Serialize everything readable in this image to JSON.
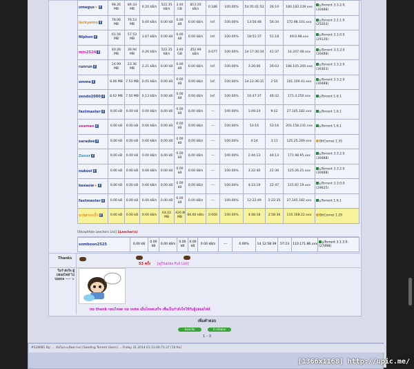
{
  "peers": [
    {
      "user": "omegus",
      "color": "#223a9a",
      "star": "★",
      "ul": "98.26 MB",
      "dl": "89.33 MB",
      "ul_rate": "0.20 kB/s",
      "dl_rate": "522.35 kB/s",
      "size": "3.40 GB",
      "ratio_rate": "813.20 kB/s",
      "ratio": "0.186",
      "ratio_red": true,
      "complete": "100.00%",
      "connected": "5d 05:41:53",
      "idle": "26:10",
      "ip": "180.183.239.xxx",
      "client": "µTorrent 3.3.2.0. (30488)",
      "client_icon": "flag"
    },
    {
      "user": "luckyemu",
      "color": "#e09020",
      "star": "",
      "ul": "78.06 MB",
      "dl": "76.53 MB",
      "ul_rate": "0.00 kB/s",
      "dl_rate": "0.00 kB",
      "size": "0.00 kB",
      "ratio_rate": "0.00 kB/s",
      "ratio": "Inf.",
      "ratio_red": false,
      "complete": "100.00%",
      "connected": "13:56:48",
      "idle": "56:34",
      "ip": "172.98.101.xxx",
      "client": "µTorrent 2.2.1.0. (25203)",
      "client_icon": "flag"
    },
    {
      "user": "Niphon",
      "color": "#223a9a",
      "star": "",
      "ul": "61.56 MB",
      "dl": "57.53 MB",
      "ul_rate": "1.67 kB/s",
      "dl_rate": "0.00 kB",
      "size": "0.00 kB",
      "ratio_rate": "0.00 kB/s",
      "ratio": "Inf.",
      "ratio_red": false,
      "complete": "100.00%",
      "connected": "18:51:37",
      "idle": "51:18",
      "ip": "49.0.98.xxx",
      "client": "µTorrent 3.3.0.0. (29126)",
      "client_icon": "flag"
    },
    {
      "user": "min2524",
      "color": "#d020a0",
      "star": "",
      "ul": "40.26 MB",
      "dl": "36.94 MB",
      "ul_rate": "0.26 kB/s",
      "dl_rate": "522.35 kB/s",
      "size": "3.40 GB",
      "ratio_rate": "352.99 kB/s",
      "ratio": "0.077",
      "ratio_red": true,
      "complete": "100.00%",
      "connected": "1d 17:30:34",
      "idle": "41:37",
      "ip": "14.207.48.xxx",
      "client": "µTorrent 3.3.2.0. (30488)",
      "client_icon": "flag"
    },
    {
      "user": "runrun",
      "color": "#223a9a",
      "star": "",
      "ul": "24.99 MB",
      "dl": "23.36 MB",
      "ul_rate": "2.21 kB/s",
      "dl_rate": "0.00 kB",
      "size": "0.00 kB",
      "ratio_rate": "0.00 kB/s",
      "ratio": "Inf.",
      "ratio_red": false,
      "complete": "100.00%",
      "connected": "3:26:06",
      "idle": "26:03",
      "ip": "184.105.205.xxx",
      "client": "µTorrent 3.3.2.0. (30303)",
      "client_icon": "flag"
    },
    {
      "user": "emme",
      "color": "#223a9a",
      "star": "",
      "ul": "8.06 MB",
      "dl": "7.53 MB",
      "ul_rate": "0.05 kB/s",
      "dl_rate": "0.00 kB",
      "size": "0.00 kB",
      "ratio_rate": "0.00 kB/s",
      "ratio": "Inf.",
      "ratio_red": false,
      "complete": "100.00%",
      "connected": "1d 23:36:31",
      "idle": "2:55",
      "ip": "101.109.41.xxx",
      "client": "µTorrent 3.3.2.0. (30488)",
      "client_icon": "flag"
    },
    {
      "user": "zendo2000",
      "color": "#223a9a",
      "star": "",
      "ul": "8.02 MB",
      "dl": "7.50 MB",
      "ul_rate": "0.13 kB/s",
      "dl_rate": "0.00 kB",
      "size": "0.00 kB",
      "ratio_rate": "0.00 kB/s",
      "ratio": "Inf.",
      "ratio_red": false,
      "complete": "100.00%",
      "connected": "16:47:37",
      "idle": "46:42",
      "ip": "171.4.250.xxx",
      "client": "µTorrent 1.6.1",
      "client_icon": "flag"
    },
    {
      "user": "fastmaster",
      "color": "#223a9a",
      "star": "",
      "ul": "0.00 kB",
      "dl": "0.00 kB",
      "ul_rate": "0.00 kB/s",
      "dl_rate": "0.00 kB",
      "size": "0.00 kB",
      "ratio_rate": "0.00 kB/s",
      "ratio": "---",
      "ratio_red": false,
      "complete": "100.00%",
      "connected": "1:09:24",
      "idle": "9:22",
      "ip": "27.145.182.xxx",
      "client": "µTorrent 1.6.1",
      "client_icon": "flag"
    },
    {
      "user": "seaman",
      "color": "#d020a0",
      "star": "",
      "ul": "0.00 kB",
      "dl": "0.00 kB",
      "ul_rate": "0.00 kB/s",
      "dl_rate": "0.00 kB",
      "size": "0.00 kB",
      "ratio_rate": "0.00 kB/s",
      "ratio": "---",
      "ratio_red": false,
      "complete": "100.00%",
      "connected": "53:16",
      "idle": "53:16",
      "ip": "203.158.231.xxx",
      "client": "µTorrent 1.6.1",
      "client_icon": "flag"
    },
    {
      "user": "saradee",
      "color": "#223a9a",
      "star": "",
      "ul": "0.00 kB",
      "dl": "0.00 kB",
      "ul_rate": "0.00 kB/s",
      "dl_rate": "0.00 kB",
      "size": "0.00 kB",
      "ratio_rate": "0.00 kB/s",
      "ratio": "---",
      "ratio_red": false,
      "complete": "100.00%",
      "connected": "4:24",
      "idle": "3:11",
      "ip": "125.25.249.xxx",
      "client": "BitComet 1.35",
      "client_icon": "bc"
    },
    {
      "user": "Zenor",
      "color": "#4a8ab0",
      "star": "",
      "ul": "0.00 kB",
      "dl": "0.00 kB",
      "ul_rate": "0.00 kB/s",
      "dl_rate": "0.00 kB",
      "size": "0.00 kB",
      "ratio_rate": "0.00 kB/s",
      "ratio": "---",
      "ratio_red": false,
      "complete": "100.00%",
      "connected": "2:44:13",
      "idle": "44:13",
      "ip": "171.98.95.xxx",
      "client": "µTorrent 3.3.2.0. (30488)",
      "client_icon": "flag"
    },
    {
      "user": "nukool",
      "color": "#223a9a",
      "star": "",
      "ul": "0.00 kB",
      "dl": "0.00 kB",
      "ul_rate": "0.00 kB/s",
      "dl_rate": "0.00 kB",
      "size": "0.00 kB",
      "ratio_rate": "0.00 kB/s",
      "ratio": "---",
      "ratio_red": false,
      "complete": "100.00%",
      "connected": "3:22:40",
      "idle": "22:36",
      "ip": "125.26.21.xxx",
      "client": "µTorrent 3.3.2.0. (30488)",
      "client_icon": "flag"
    },
    {
      "user": "keeaow",
      "color": "#223a9a",
      "star": "★",
      "ul": "0.00 kB",
      "dl": "0.00 kB",
      "ul_rate": "0.00 kB/s",
      "dl_rate": "0.00 kB",
      "size": "0.00 kB",
      "ratio_rate": "0.00 kB/s",
      "ratio": "---",
      "ratio_red": false,
      "complete": "100.00%",
      "connected": "4:23:19",
      "idle": "22:47",
      "ip": "115.87.19.xxx",
      "client": "µTorrent 3.3.0.0. (29625)",
      "client_icon": "flag"
    },
    {
      "user": "fastmaster",
      "color": "#223a9a",
      "star": "",
      "ul": "0.00 kB",
      "dl": "0.00 kB",
      "ul_rate": "0.00 kB/s",
      "dl_rate": "0.00 kB",
      "size": "0.00 kB",
      "ratio_rate": "0.00 kB/s",
      "ratio": "---",
      "ratio_red": false,
      "complete": "100.00%",
      "connected": "12:22:49",
      "idle": "2:22:35",
      "ip": "27.145.182.xxx",
      "client": "µTorrent 1.6.1",
      "client_icon": "flag"
    },
    {
      "user": "นายสาระเร็ว",
      "color": "#e09020",
      "star": "",
      "ul": "0.00 kB",
      "dl": "0.00 kB",
      "ul_rate": "0.00 kB/s",
      "dl_rate": "64.02 MB",
      "size": "426.80 MB",
      "ratio_rate": "66.60 kB/s",
      "ratio": "0.000",
      "ratio_red": true,
      "complete": "100.00%",
      "connected": "4:48:18",
      "idle": "2:58:36",
      "ip": "110.168.22.xxx",
      "client": "BitComet 1.29",
      "client_icon": "bc",
      "highlight": true
    }
  ],
  "status": {
    "prefix": "[Show/Hide Leechers List]",
    "leechers": "1Leecher(s)"
  },
  "leecher": {
    "user": "somboon2525",
    "ul": "0.00 kB",
    "dl": "0.00 kB",
    "ul_rate": "0.00 kB/s",
    "dl_rate": "0.00 kB",
    "size": "0.00 kB",
    "ratio_rate": "0.00 kB/s",
    "ratio": "---",
    "complete": "0.00%",
    "connected": "1d 12:58:39",
    "idle": "57:23",
    "ip": "110.171.86.xxx",
    "client": "µTorrent 3.1.3.0. (27498)"
  },
  "thanks": {
    "label": "Thanks",
    "count": "53 ครั้ง",
    "full_list": "[ดูThanks Full List]"
  },
  "signature": {
    "label": "ใบกำลังใจ ผู้ปล่อยไฟล์ ไปบ่อยกล ~~ >",
    "text": "no thank กดบไหลด no vote เมื่อโหลดเสร็จ เพื่อเป็นกำลังใจให้กับผู้ปล่อยไฟล์"
  },
  "footer": {
    "title": "เพิ่มคำตอบ",
    "btn1": "ตอบกลับ",
    "btn2": "อ้างอิงตอบ",
    "pages": "1 - 3"
  },
  "next_post": {
    "text": "#528081 By: ... (ยังไม่ระบุข้อความ) [Seeding Torrent Users] ... Friday 31.2014 01:31:00:71:37 [10:9x]"
  },
  "watermark": "[1366x1168] http://upic.me/"
}
